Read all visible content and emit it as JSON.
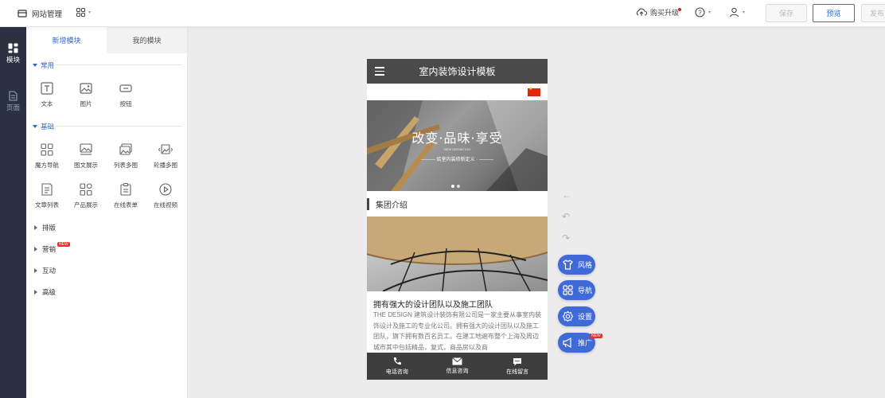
{
  "topbar": {
    "site_label": "网站管理",
    "upgrade_label": "购买升级",
    "save_label": "保存",
    "preview_label": "预览",
    "publish_label": "发布",
    "icons": [
      "site-icon",
      "apps-grid-icon",
      "cloud-upgrade-icon",
      "help-icon",
      "user-icon"
    ]
  },
  "rail": {
    "items": [
      {
        "label": "模块",
        "icon": "blocks-icon",
        "active": true
      },
      {
        "label": "页面",
        "icon": "page-icon",
        "active": false
      }
    ]
  },
  "panel": {
    "tabs": [
      {
        "label": "新增模块",
        "active": true
      },
      {
        "label": "我的模块",
        "active": false
      }
    ],
    "sections": [
      {
        "title": "常用",
        "items": [
          {
            "label": "文本",
            "icon": "text-icon"
          },
          {
            "label": "图片",
            "icon": "image-icon"
          },
          {
            "label": "按钮",
            "icon": "button-icon"
          }
        ]
      },
      {
        "title": "基础",
        "items": [
          {
            "label": "魔方导航",
            "icon": "cube-nav-icon"
          },
          {
            "label": "图文展示",
            "icon": "image-text-icon"
          },
          {
            "label": "列表多图",
            "icon": "multi-image-icon"
          },
          {
            "label": "轮播多图",
            "icon": "carousel-icon"
          },
          {
            "label": "文章列表",
            "icon": "article-list-icon"
          },
          {
            "label": "产品展示",
            "icon": "product-icon"
          },
          {
            "label": "在线表单",
            "icon": "form-icon"
          },
          {
            "label": "在线视频",
            "icon": "video-icon"
          }
        ]
      }
    ],
    "categories": [
      {
        "label": "排版",
        "badge": ""
      },
      {
        "label": "营销",
        "badge": "NEW"
      },
      {
        "label": "互动",
        "badge": ""
      },
      {
        "label": "高级",
        "badge": ""
      }
    ]
  },
  "phone": {
    "header_title": "室内装饰设计模板",
    "banner_text": "改变·品味·享受",
    "banner_small": "NEW DEFINITION",
    "banner_sub": "——— 给室内装修新定义 · ———",
    "section_title": "集团介绍",
    "article_title": "拥有强大的设计团队以及施工团队",
    "article_body": "THE DESIGN 建筑设计装饰有限公司是一家主要从事室内装饰设计及施工的专业化公司。拥有强大的设计团队以及施工团队，旗下拥有数百名员工。在建工地遍布整个上海及周边城市其中包括精品，复式，商品房以及商",
    "footer": [
      {
        "label": "电话咨询",
        "icon": "phone-icon"
      },
      {
        "label": "信息咨询",
        "icon": "mail-icon"
      },
      {
        "label": "在线留言",
        "icon": "message-icon"
      }
    ]
  },
  "floating": {
    "buttons": [
      {
        "label": "风格",
        "icon": "shirt-icon"
      },
      {
        "label": "导航",
        "icon": "nav-grid-icon"
      },
      {
        "label": "设置",
        "icon": "settings-icon"
      },
      {
        "label": "推广",
        "icon": "megaphone-icon",
        "badge": "NEW"
      }
    ]
  },
  "colors": {
    "accent": "#3068c8",
    "fab": "#3f6ad8",
    "rail": "#2b3140"
  }
}
